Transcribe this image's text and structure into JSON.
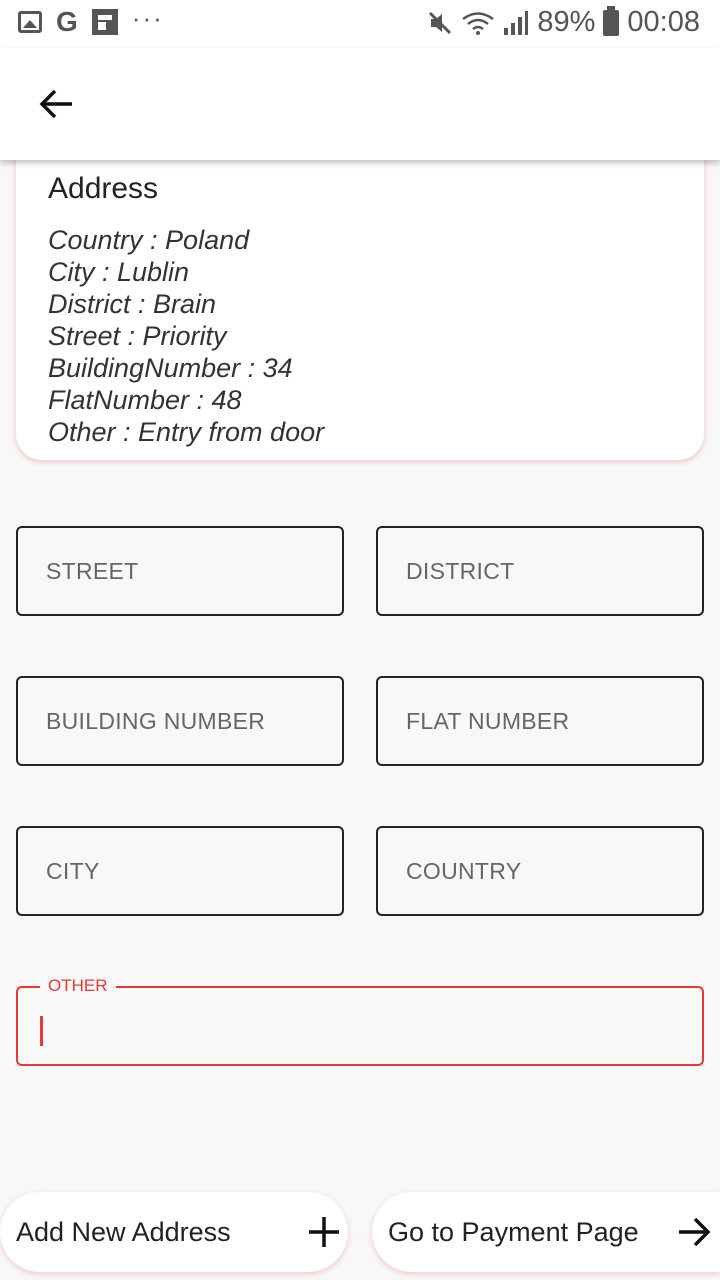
{
  "status_bar": {
    "battery": "89%",
    "time": "00:08",
    "g_letter": "G",
    "dots": "···"
  },
  "app_bar": {
    "back_icon": "arrow-left-icon"
  },
  "address_card": {
    "title": "Address",
    "lines": [
      "Country :  Poland",
      "City :  Lublin",
      "District :  Brain",
      "Street :  Priority",
      "BuildingNumber :  34",
      "FlatNumber :  48",
      "Other :  Entry from door"
    ]
  },
  "form": {
    "street": "STREET",
    "district": "DISTRICT",
    "building_number": "BUILDING NUMBER",
    "flat_number": "FLAT NUMBER",
    "city": "CITY",
    "country": "COUNTRY",
    "other": "OTHER",
    "other_value": ""
  },
  "buttons": {
    "add_address": "Add New Address",
    "add_icon": "plus-icon",
    "go_payment": "Go to Payment Page",
    "go_icon": "arrow-right-icon"
  },
  "colors": {
    "accent": "#e53935",
    "background": "#f8f8f8"
  }
}
